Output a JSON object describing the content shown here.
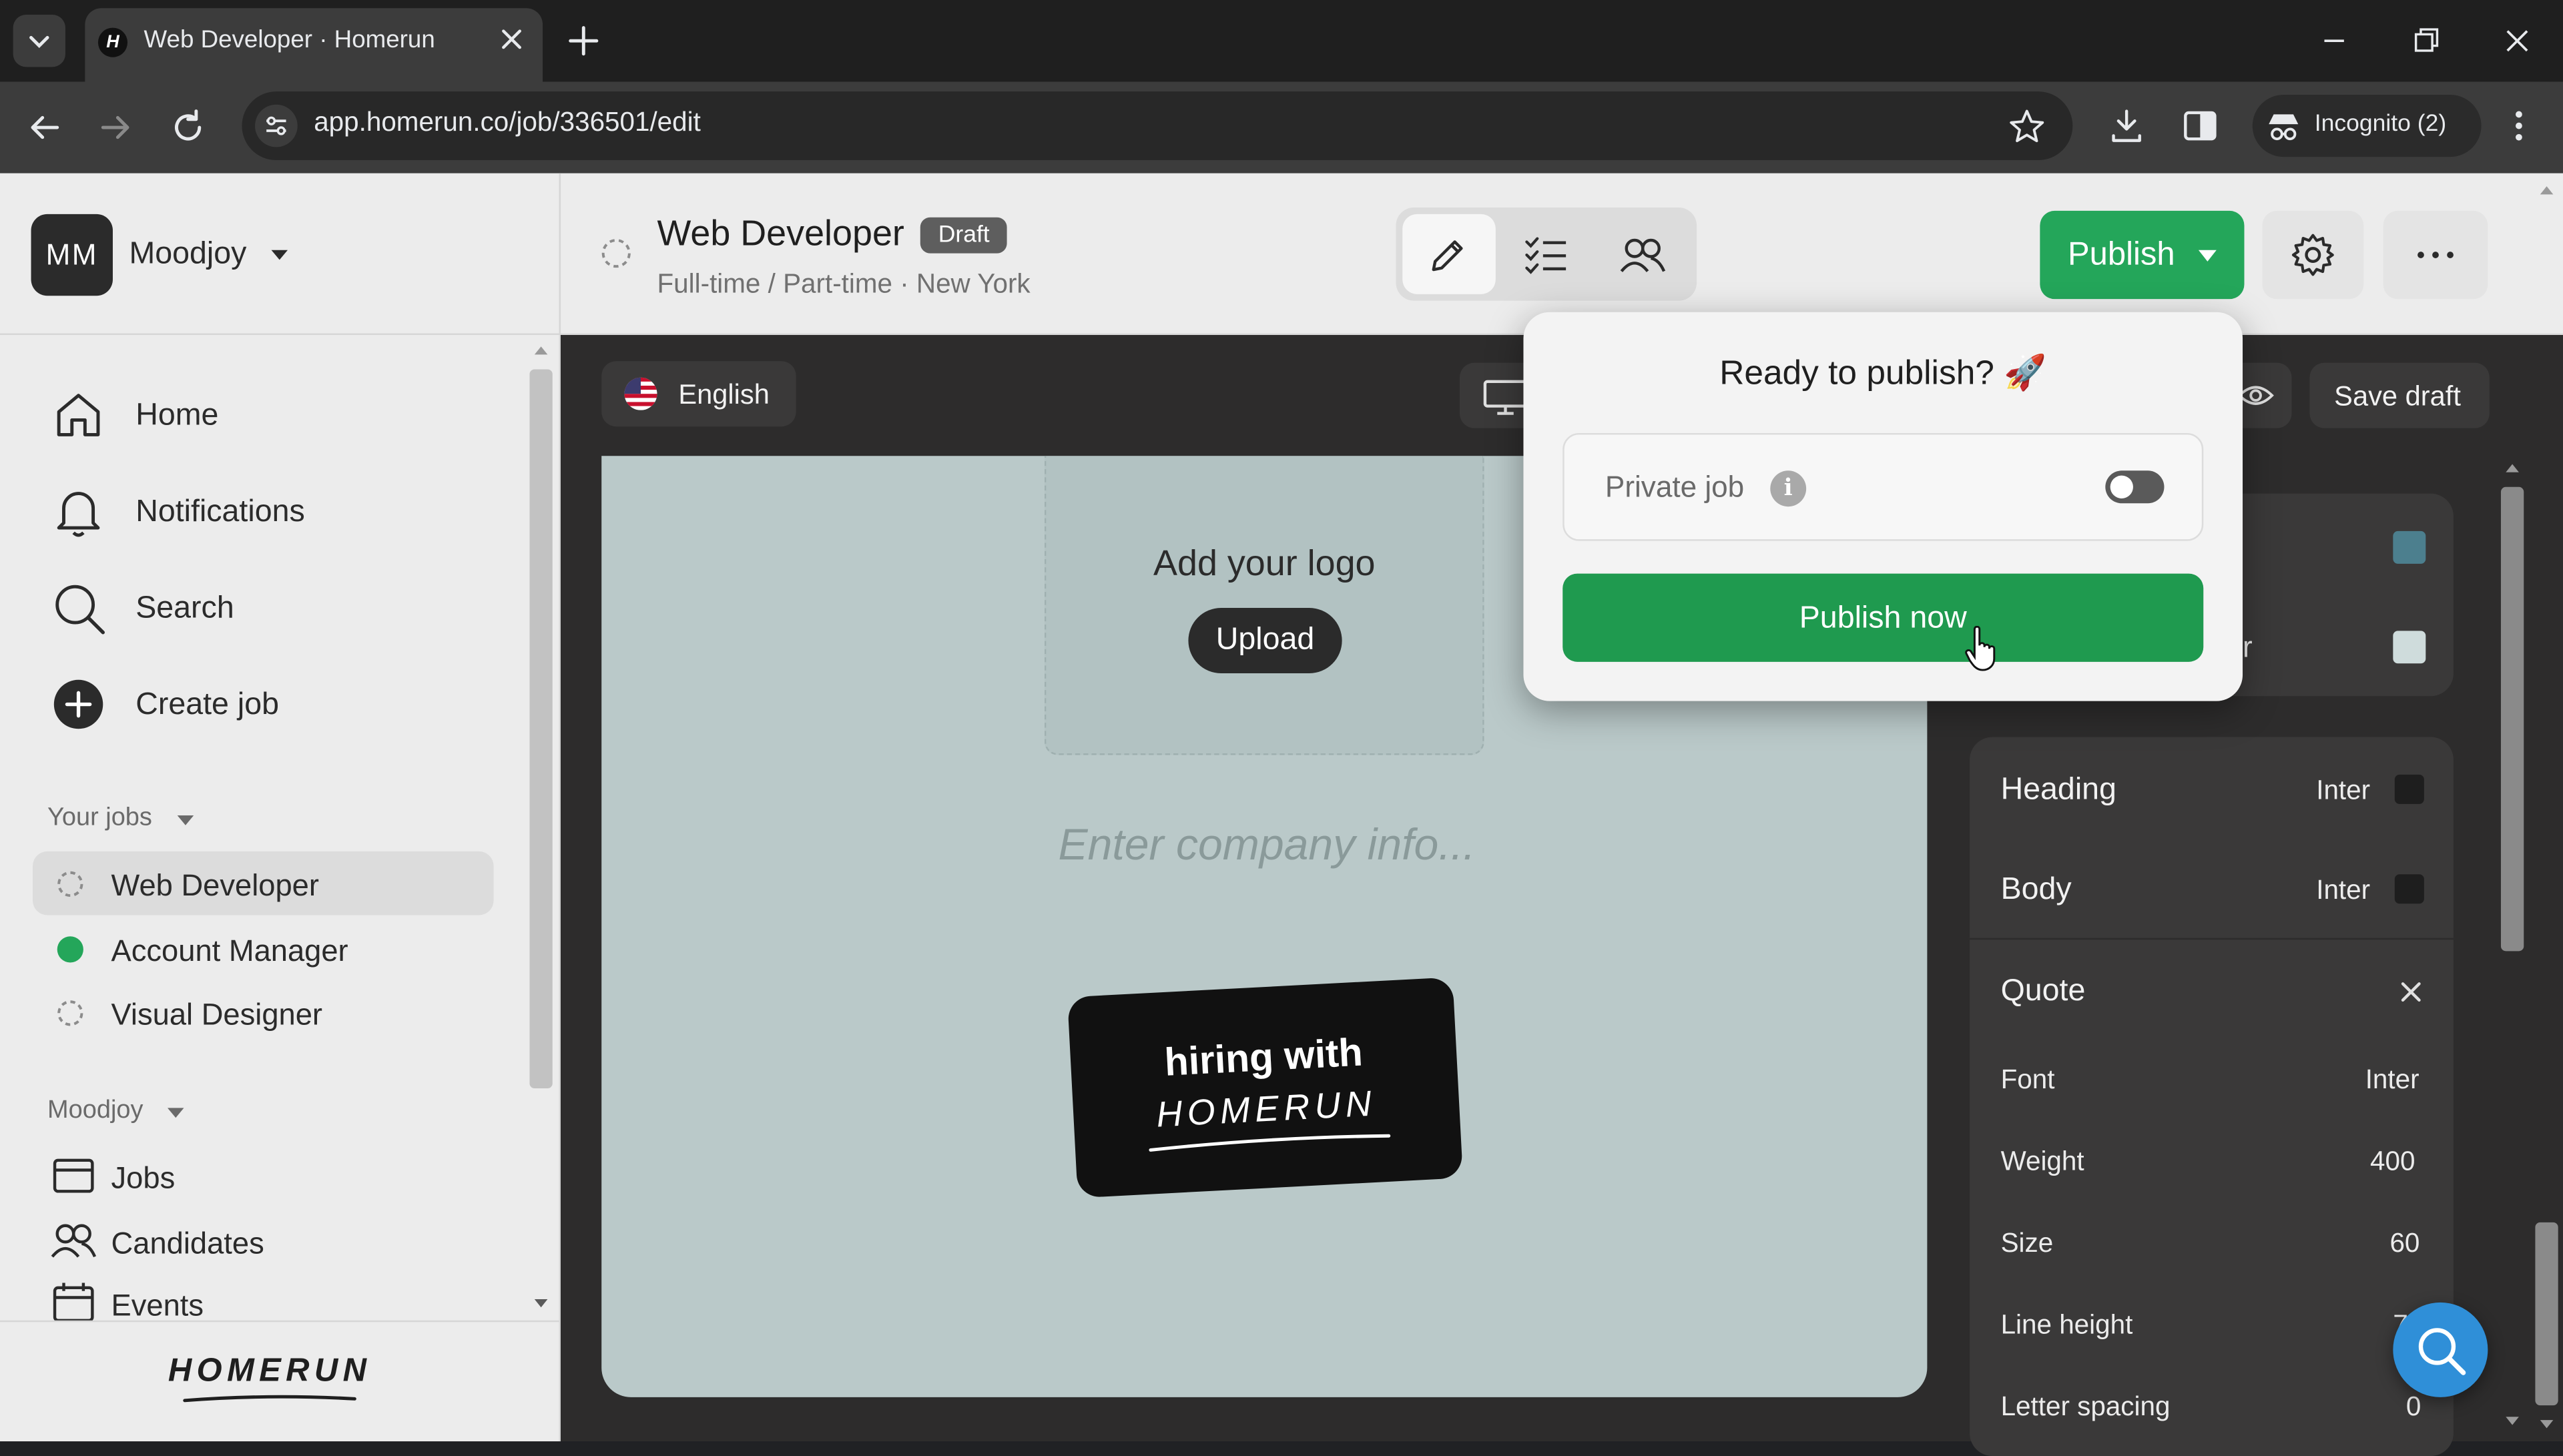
{
  "browser": {
    "tab_title": "Web Developer · Homerun",
    "url": "app.homerun.co/job/336501/edit",
    "incognito_label": "Incognito (2)"
  },
  "workspace": {
    "initials": "MM",
    "name": "Moodjoy"
  },
  "nav": {
    "home": "Home",
    "notifications": "Notifications",
    "search": "Search",
    "create_job": "Create job"
  },
  "your_jobs": {
    "heading": "Your jobs",
    "items": [
      {
        "label": "Web Developer",
        "status": "draft"
      },
      {
        "label": "Account Manager",
        "status": "published"
      },
      {
        "label": "Visual Designer",
        "status": "draft"
      }
    ]
  },
  "moodjoy_section": {
    "heading": "Moodjoy",
    "items": [
      {
        "label": "Jobs",
        "icon": "jobs-icon"
      },
      {
        "label": "Candidates",
        "icon": "candidates-icon"
      },
      {
        "label": "Events",
        "icon": "calendar-icon"
      }
    ]
  },
  "brand": {
    "logo_text": "HOMERUN"
  },
  "job": {
    "title": "Web Developer",
    "status_badge": "Draft",
    "meta": "Full-time / Part-time · New York"
  },
  "actions": {
    "publish_label": "Publish",
    "save_draft_label": "Save draft",
    "language_label": "English"
  },
  "canvas": {
    "add_logo_text": "Add your logo",
    "upload_label": "Upload",
    "company_info_placeholder": "Enter company info...",
    "badge_line1": "hiring with",
    "badge_line2": "HOMERUN"
  },
  "publish_popup": {
    "title": "Ready to publish? 🚀",
    "private_job_label": "Private job",
    "private_job_enabled": false,
    "publish_now_label": "Publish now"
  },
  "style_panel": {
    "partial_label": "r",
    "heading_label": "Heading",
    "heading_font": "Inter",
    "body_label": "Body",
    "body_font": "Inter",
    "quote_label": "Quote",
    "font_label": "Font",
    "font_value": "Inter",
    "weight_label": "Weight",
    "weight_value": "400",
    "size_label": "Size",
    "size_value": "60",
    "line_height_label": "Line height",
    "line_height_value": "7",
    "letter_spacing_label": "Letter spacing",
    "letter_spacing_value": "0"
  },
  "colors": {
    "accent_green": "#24a65a",
    "publish_now_green": "#1f9a4f",
    "canvas_bg": "#bac9c9",
    "swatch_teal": "#4c7f8e",
    "swatch_light": "#cfdcdc"
  }
}
